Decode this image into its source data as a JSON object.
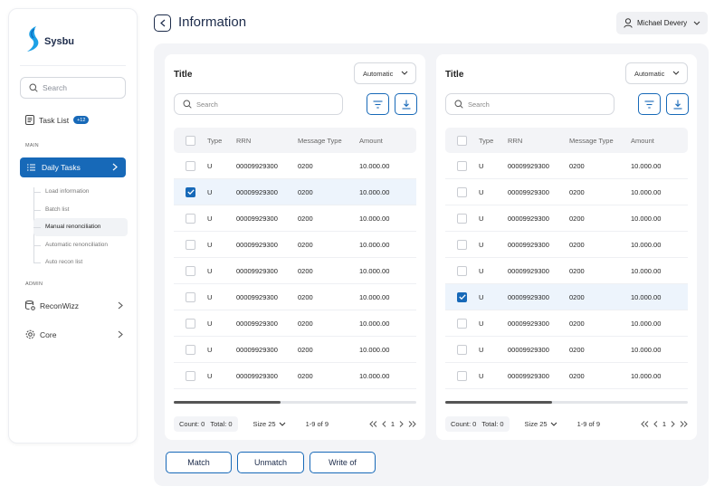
{
  "sidebar": {
    "logo_text": "Sysbu",
    "search_placeholder": "Search",
    "task_list_label": "Task List",
    "task_list_badge": "+12",
    "main_section": "MAIN",
    "daily_tasks": "Daily Tasks",
    "sub_items": [
      "Load information",
      "Batch list",
      "Manual renonciliation",
      "Automatic renonciliation",
      "Auto recon list"
    ],
    "admin_section": "ADMIN",
    "reconwizz": "ReconWizz",
    "core": "Core"
  },
  "header": {
    "title": "Information",
    "user": "Michael Devery"
  },
  "colors": {
    "accent": "#1769b8",
    "selected_row": "#edf4fc",
    "main_bg": "#f3f4f7"
  },
  "panels": [
    {
      "title": "Title",
      "select": "Automatic",
      "search_placeholder": "Search",
      "columns": [
        "Type",
        "RRN",
        "Message Type",
        "Amount"
      ],
      "rows": [
        {
          "checked": false,
          "type": "U",
          "rrn": "00009929300",
          "mt": "0200",
          "amount": "10.000.00"
        },
        {
          "checked": true,
          "type": "U",
          "rrn": "00009929300",
          "mt": "0200",
          "amount": "10.000.00"
        },
        {
          "checked": false,
          "type": "U",
          "rrn": "00009929300",
          "mt": "0200",
          "amount": "10.000.00"
        },
        {
          "checked": false,
          "type": "U",
          "rrn": "00009929300",
          "mt": "0200",
          "amount": "10.000.00"
        },
        {
          "checked": false,
          "type": "U",
          "rrn": "00009929300",
          "mt": "0200",
          "amount": "10.000.00"
        },
        {
          "checked": false,
          "type": "U",
          "rrn": "00009929300",
          "mt": "0200",
          "amount": "10.000.00"
        },
        {
          "checked": false,
          "type": "U",
          "rrn": "00009929300",
          "mt": "0200",
          "amount": "10.000.00"
        },
        {
          "checked": false,
          "type": "U",
          "rrn": "00009929300",
          "mt": "0200",
          "amount": "10.000.00"
        },
        {
          "checked": false,
          "type": "U",
          "rrn": "00009929300",
          "mt": "0200",
          "amount": "10.000.00"
        }
      ],
      "footer": {
        "count": "Count: 0",
        "total": "Total: 0",
        "size": "Size 25",
        "range": "1-9 of 9",
        "page": "1"
      }
    },
    {
      "title": "Title",
      "select": "Automatic",
      "search_placeholder": "Search",
      "columns": [
        "Type",
        "RRN",
        "Message Type",
        "Amount"
      ],
      "rows": [
        {
          "checked": false,
          "type": "U",
          "rrn": "00009929300",
          "mt": "0200",
          "amount": "10.000.00"
        },
        {
          "checked": false,
          "type": "U",
          "rrn": "00009929300",
          "mt": "0200",
          "amount": "10.000.00"
        },
        {
          "checked": false,
          "type": "U",
          "rrn": "00009929300",
          "mt": "0200",
          "amount": "10.000.00"
        },
        {
          "checked": false,
          "type": "U",
          "rrn": "00009929300",
          "mt": "0200",
          "amount": "10.000.00"
        },
        {
          "checked": false,
          "type": "U",
          "rrn": "00009929300",
          "mt": "0200",
          "amount": "10.000.00"
        },
        {
          "checked": true,
          "type": "U",
          "rrn": "00009929300",
          "mt": "0200",
          "amount": "10.000.00"
        },
        {
          "checked": false,
          "type": "U",
          "rrn": "00009929300",
          "mt": "0200",
          "amount": "10.000.00"
        },
        {
          "checked": false,
          "type": "U",
          "rrn": "00009929300",
          "mt": "0200",
          "amount": "10.000.00"
        },
        {
          "checked": false,
          "type": "U",
          "rrn": "00009929300",
          "mt": "0200",
          "amount": "10.000.00"
        }
      ],
      "footer": {
        "count": "Count: 0",
        "total": "Total: 0",
        "size": "Size 25",
        "range": "1-9 of 9",
        "page": "1"
      }
    }
  ],
  "actions": {
    "match": "Match",
    "unmatch": "Unmatch",
    "write_of": "Write of"
  }
}
